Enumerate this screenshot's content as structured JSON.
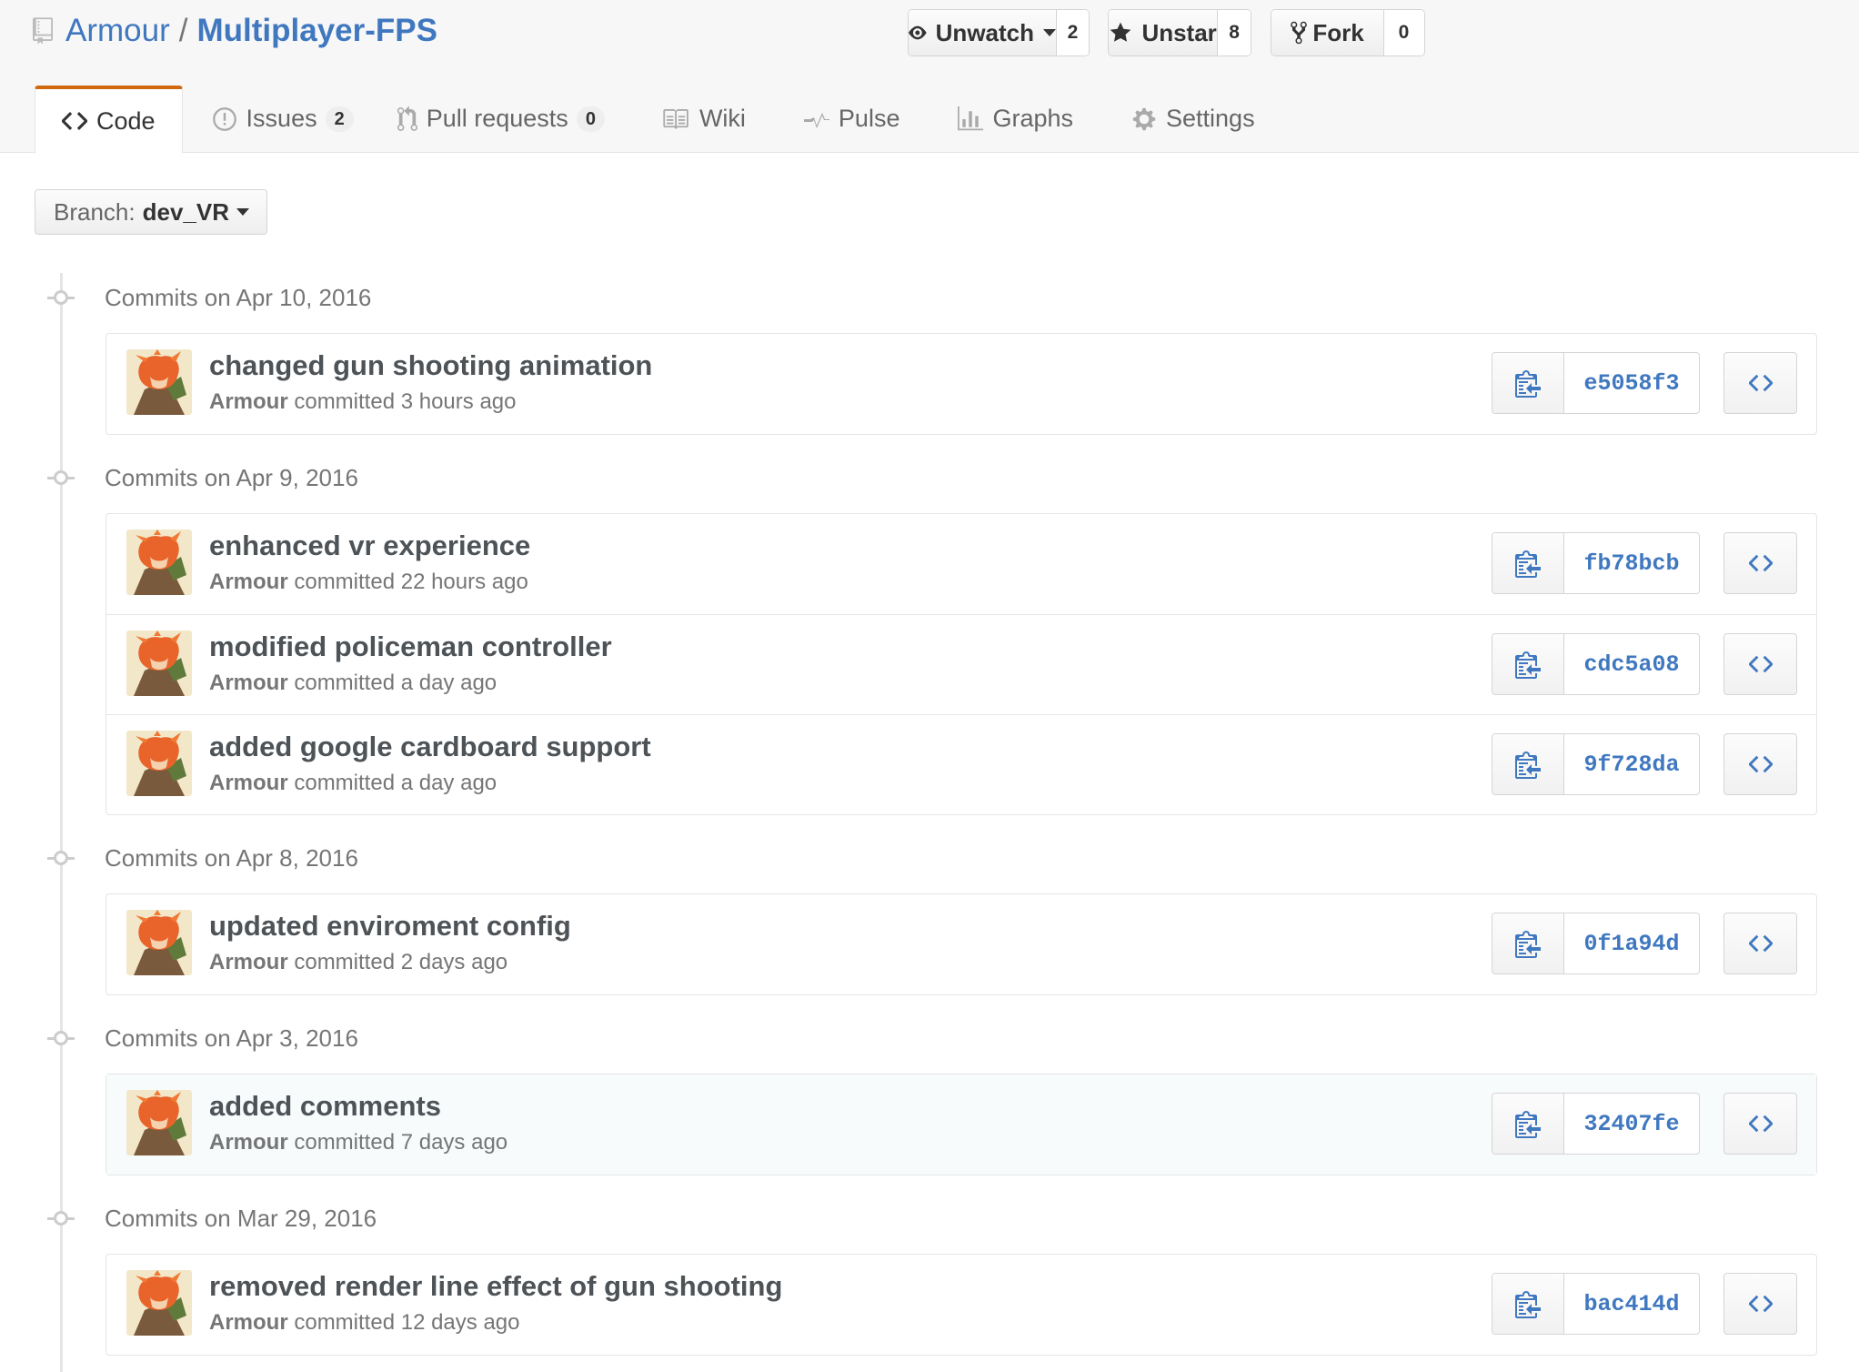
{
  "repo": {
    "owner": "Armour",
    "separator": "/",
    "name": "Multiplayer-FPS"
  },
  "actions": {
    "watch": {
      "label": "Unwatch",
      "count": "2"
    },
    "star": {
      "label": "Unstar",
      "count": "8"
    },
    "fork": {
      "label": "Fork",
      "count": "0"
    }
  },
  "tabs": {
    "code": "Code",
    "issues": {
      "label": "Issues",
      "count": "2"
    },
    "pulls": {
      "label": "Pull requests",
      "count": "0"
    },
    "wiki": "Wiki",
    "pulse": "Pulse",
    "graphs": "Graphs",
    "settings": "Settings"
  },
  "branch": {
    "label": "Branch:",
    "name": "dev_VR"
  },
  "groups": [
    {
      "title": "Commits on Apr 10, 2016",
      "commits": [
        {
          "message": "changed gun shooting animation",
          "author": "Armour",
          "verb": "committed",
          "time": "3 hours ago",
          "sha": "e5058f3"
        }
      ]
    },
    {
      "title": "Commits on Apr 9, 2016",
      "commits": [
        {
          "message": "enhanced vr experience",
          "author": "Armour",
          "verb": "committed",
          "time": "22 hours ago",
          "sha": "fb78bcb"
        },
        {
          "message": "modified policeman controller",
          "author": "Armour",
          "verb": "committed",
          "time": "a day ago",
          "sha": "cdc5a08"
        },
        {
          "message": "added google cardboard support",
          "author": "Armour",
          "verb": "committed",
          "time": "a day ago",
          "sha": "9f728da"
        }
      ]
    },
    {
      "title": "Commits on Apr 8, 2016",
      "commits": [
        {
          "message": "updated enviroment config",
          "author": "Armour",
          "verb": "committed",
          "time": "2 days ago",
          "sha": "0f1a94d"
        }
      ]
    },
    {
      "title": "Commits on Apr 3, 2016",
      "commits": [
        {
          "message": "added comments",
          "author": "Armour",
          "verb": "committed",
          "time": "7 days ago",
          "sha": "32407fe"
        }
      ]
    },
    {
      "title": "Commits on Mar 29, 2016",
      "commits": [
        {
          "message": "removed render line effect of gun shooting",
          "author": "Armour",
          "verb": "committed",
          "time": "12 days ago",
          "sha": "bac414d"
        }
      ]
    }
  ],
  "colors": {
    "link": "#4078c0",
    "accent": "#d26911",
    "muted": "#767676"
  },
  "icons": [
    "repo-icon",
    "eye-icon",
    "star-icon",
    "fork-icon",
    "code-icon",
    "issue-icon",
    "pull-request-icon",
    "wiki-icon",
    "pulse-icon",
    "graph-icon",
    "gear-icon",
    "clipboard-icon",
    "browse-code-icon",
    "avatar"
  ]
}
